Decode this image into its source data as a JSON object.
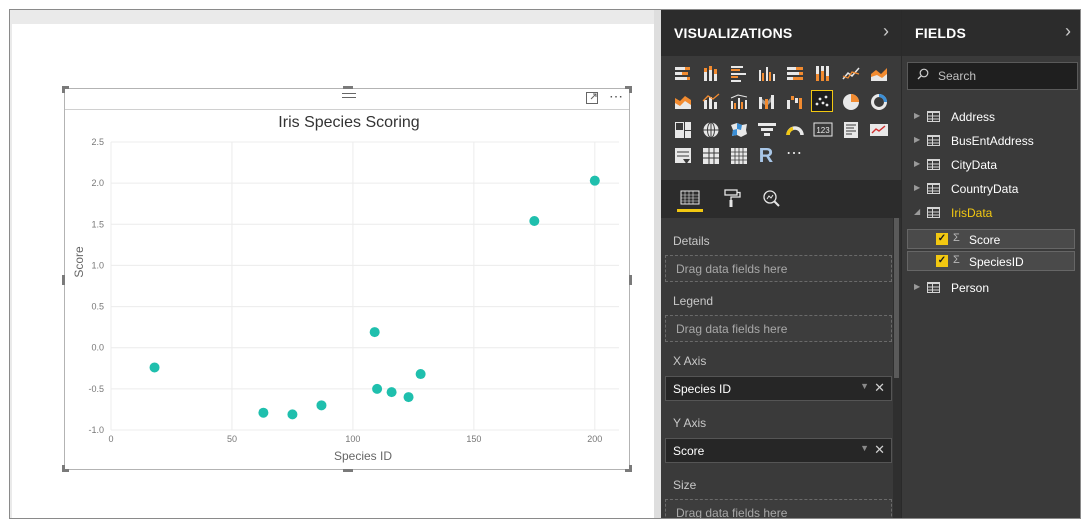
{
  "visual": {
    "more_icon": "ellipsis-icon",
    "focus_icon": "focus-mode-icon"
  },
  "chart_data": {
    "type": "scatter",
    "title": "Iris Species Scoring",
    "xlabel": "Species ID",
    "ylabel": "Score",
    "xlim": [
      0,
      210
    ],
    "ylim": [
      -1.0,
      2.5
    ],
    "x_ticks": [
      "0",
      "50",
      "100",
      "150",
      "200"
    ],
    "y_ticks": [
      "2.5",
      "2.0",
      "1.5",
      "1.0",
      "0.5",
      "0.0",
      "-0.5",
      "-1.0"
    ],
    "grid": true,
    "marker_color": "#1fbfad",
    "points": [
      {
        "x": 18,
        "y": -0.24
      },
      {
        "x": 63,
        "y": -0.79
      },
      {
        "x": 75,
        "y": -0.81
      },
      {
        "x": 87,
        "y": -0.7
      },
      {
        "x": 109,
        "y": 0.19
      },
      {
        "x": 110,
        "y": -0.5
      },
      {
        "x": 116,
        "y": -0.54
      },
      {
        "x": 123,
        "y": -0.6
      },
      {
        "x": 128,
        "y": -0.32
      },
      {
        "x": 175,
        "y": 1.54
      },
      {
        "x": 200,
        "y": 2.03
      }
    ]
  },
  "visualizations": {
    "title": "VISUALIZATIONS",
    "chevron": "chevron-right-icon",
    "more_visuals": "⋯",
    "r_visual_label": "R",
    "card_label": "123"
  },
  "wells": {
    "details_label": "Details",
    "details_placeholder": "Drag data fields here",
    "legend_label": "Legend",
    "legend_placeholder": "Drag data fields here",
    "xaxis_label": "X Axis",
    "xaxis_field": "Species ID",
    "yaxis_label": "Y Axis",
    "yaxis_field": "Score",
    "size_label": "Size",
    "size_placeholder": "Drag data fields here"
  },
  "fields": {
    "title": "FIELDS",
    "search_placeholder": "Search",
    "tables": [
      {
        "name": "Address",
        "expanded": false
      },
      {
        "name": "BusEntAddress",
        "expanded": false
      },
      {
        "name": "CityData",
        "expanded": false
      },
      {
        "name": "CountryData",
        "expanded": false
      },
      {
        "name": "IrisData",
        "expanded": true
      },
      {
        "name": "Person",
        "expanded": false
      }
    ],
    "iris_fields": [
      {
        "name": "Score",
        "checked": true
      },
      {
        "name": "SpeciesID",
        "checked": true
      }
    ],
    "accent_color": "#f2c811"
  }
}
